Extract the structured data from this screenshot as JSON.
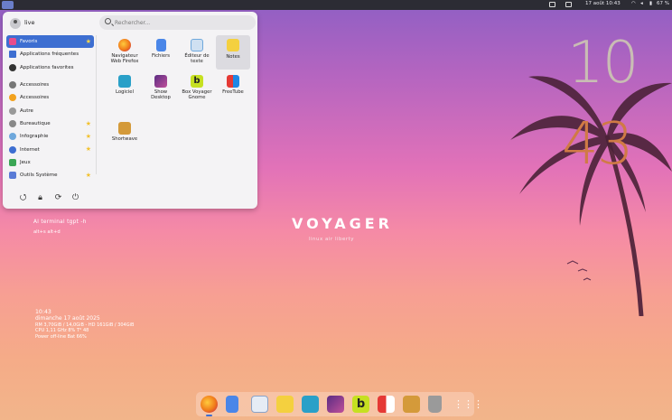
{
  "topbar": {
    "date_time": "17 août  10:43",
    "battery": "67 %"
  },
  "menu": {
    "user": "live",
    "search_placeholder": "Rechercher...",
    "categories": [
      {
        "label": "Favoris",
        "icon": "heart-icon",
        "color": "#e74c8c",
        "star": true,
        "selected": true
      },
      {
        "label": "Applications fréquentes",
        "icon": "folder-icon",
        "color": "#3d6ed1",
        "star": false
      },
      {
        "label": "Applications favorites",
        "icon": "pin-icon",
        "color": "#333333",
        "star": false
      },
      {
        "label": "Accessoires",
        "icon": "accessories-icon",
        "color": "#777777",
        "star": false
      },
      {
        "label": "Accessoires",
        "icon": "accessories-alt-icon",
        "color": "#f2a21e",
        "star": false
      },
      {
        "label": "Autre",
        "icon": "other-icon",
        "color": "#999999",
        "star": false
      },
      {
        "label": "Bureautique",
        "icon": "office-icon",
        "color": "#888888",
        "star": true
      },
      {
        "label": "Infographie",
        "icon": "graphics-icon",
        "color": "#6fa8dc",
        "star": true
      },
      {
        "label": "Internet",
        "icon": "internet-icon",
        "color": "#3d6ed1",
        "star": true
      },
      {
        "label": "Jeux",
        "icon": "games-icon",
        "color": "#3aa655",
        "star": false
      },
      {
        "label": "Outils Système",
        "icon": "system-tools-icon",
        "color": "#5a7bd6",
        "star": true
      }
    ],
    "apps": [
      {
        "label1": "Navigateur",
        "label2": "Web Firefox",
        "icon": "firefox-icon",
        "color": "#f07a1a"
      },
      {
        "label1": "Fichiers",
        "label2": "",
        "icon": "files-icon",
        "color": "#4a86e8"
      },
      {
        "label1": "Éditeur de",
        "label2": "texte",
        "icon": "text-editor-icon",
        "color": "#6fa8dc"
      },
      {
        "label1": "Notes",
        "label2": "",
        "icon": "notes-icon",
        "color": "#f4d03f"
      },
      {
        "label1": "Logiciel",
        "label2": "",
        "icon": "software-icon",
        "color": "#2aa0c8"
      },
      {
        "label1": "Show",
        "label2": "Desktop",
        "icon": "show-desktop-icon",
        "color": "#8e44ad"
      },
      {
        "label1": "Box Voyager",
        "label2": "Gnome",
        "icon": "box-voyager-icon",
        "color": "#c6e021"
      },
      {
        "label1": "FreeTube",
        "label2": "",
        "icon": "freetube-icon",
        "color": "#e53935"
      },
      {
        "label1": "Shortwave",
        "label2": "",
        "icon": "shortwave-icon",
        "color": "#d49a3a"
      }
    ]
  },
  "desktop": {
    "clock_hours": "10",
    "clock_minutes": "43",
    "brand": "VOYAGER",
    "brand_sub": "linux air liberty",
    "shortcut_line1": "Al  terminal  tgpt -h",
    "shortcut_line2": "alt+s   alt+d",
    "sys_time": "10:43",
    "sys_date": "dimanche 17 août 2025",
    "sys_ram": "RM 3,70GiB / 14,0GiB - HD 161GiB / 304GiB",
    "sys_cpu": "CPU 1,11 GHz 8% T° 48",
    "sys_power": "Power off-line Bat 66%"
  },
  "dock": {
    "items": [
      {
        "icon": "firefox-icon",
        "color": "#f07a1a"
      },
      {
        "icon": "files-icon",
        "color": "#4a86e8"
      },
      {
        "icon": "text-editor-icon",
        "color": "#cfd8e6"
      },
      {
        "icon": "notes-icon",
        "color": "#f4d03f"
      },
      {
        "icon": "software-icon",
        "color": "#2aa0c8"
      },
      {
        "icon": "show-desktop-icon",
        "color": "#8e44ad"
      },
      {
        "icon": "box-voyager-icon",
        "color": "#c6e021"
      },
      {
        "icon": "freetube-icon",
        "color": "#e53935"
      },
      {
        "icon": "shortwave-icon",
        "color": "#d49a3a"
      },
      {
        "icon": "trash-icon",
        "color": "#9a9a9a"
      },
      {
        "icon": "app-grid-icon",
        "color": "#ffffff"
      }
    ]
  }
}
